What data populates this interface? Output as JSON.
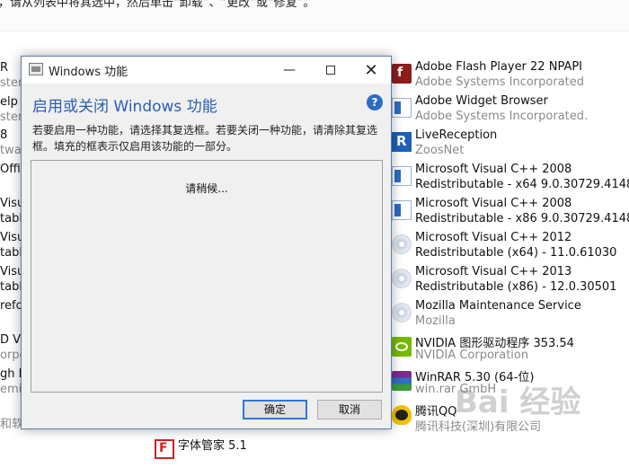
{
  "top": {
    "text": "，请从列表中将其选中，然后单击“卸载”、“更改”或“修复”。"
  },
  "left_column": [
    {
      "text": "R",
      "sub": false
    },
    {
      "text": "stem",
      "sub": true
    },
    {
      "text": "elp N",
      "sub": false
    },
    {
      "text": "stem",
      "sub": true
    },
    {
      "text": "8",
      "sub": false
    },
    {
      "text": "twa",
      "sub": true
    },
    {
      "text": "Offi",
      "sub": false
    },
    {
      "text": "Visu",
      "sub": false
    },
    {
      "text": "table",
      "sub": false
    },
    {
      "text": "Visu",
      "sub": false
    },
    {
      "text": "table",
      "sub": false
    },
    {
      "text": "Visu",
      "sub": false
    },
    {
      "text": "table",
      "sub": false
    },
    {
      "text": "refo",
      "sub": false
    },
    {
      "text": "D Vis",
      "sub": false
    },
    {
      "text": "orpo",
      "sub": true
    },
    {
      "text": "gh I",
      "sub": false
    },
    {
      "text": "emic",
      "sub": true
    },
    {
      "text": "和软",
      "sub": true
    }
  ],
  "programs": [
    {
      "name": "Adobe Flash Player 22 NPAPI",
      "publisher": "Adobe Systems Incorporated",
      "icon": "flash-icon"
    },
    {
      "name": "Adobe Widget Browser",
      "publisher": "Adobe Systems Incorporated.",
      "icon": "installer-icon"
    },
    {
      "name": "LiveReception",
      "publisher": "ZoosNet",
      "icon": "livereception-icon"
    },
    {
      "name": "Microsoft Visual C++ 2008",
      "publisher": "Redistributable - x64 9.0.30729.4148",
      "icon": "installer-icon"
    },
    {
      "name": "Microsoft Visual C++ 2008",
      "publisher": "Redistributable - x86 9.0.30729.4148",
      "icon": "installer-icon"
    },
    {
      "name": "Microsoft Visual C++ 2012",
      "publisher": "Redistributable (x64) - 11.0.61030",
      "icon": "setup-disc-icon"
    },
    {
      "name": "Microsoft Visual C++ 2013",
      "publisher": "Redistributable (x86) - 12.0.30501",
      "icon": "setup-disc-icon"
    },
    {
      "name": "Mozilla Maintenance Service",
      "publisher": "Mozilla",
      "icon": "setup-disc-icon"
    },
    {
      "name": "NVIDIA 图形驱动程序 353.54",
      "publisher": "NVIDIA Corporation",
      "icon": "nvidia-icon"
    },
    {
      "name": "WinRAR 5.30 (64-位)",
      "publisher": "win.rar GmbH",
      "icon": "winrar-icon"
    },
    {
      "name": "腾讯QQ",
      "publisher": "腾讯科技(深圳)有限公司",
      "icon": "qq-icon"
    },
    {
      "name": "字体管家 5.1",
      "publisher": "",
      "icon": "font-manager-icon"
    }
  ],
  "dialog": {
    "title": "Windows 功能",
    "heading": "启用或关闭 Windows 功能",
    "help_glyph": "?",
    "description": "若要启用一种功能，请选择其复选框。若要关闭一种功能，请清除其复选框。填充的框表示仅启用该功能的一部分。",
    "wait_text": "请稍候...",
    "ok_label": "确定",
    "cancel_label": "取消",
    "minimize_glyph": "—",
    "close_glyph": "✕"
  },
  "watermark": {
    "text": "Bai 经验"
  }
}
